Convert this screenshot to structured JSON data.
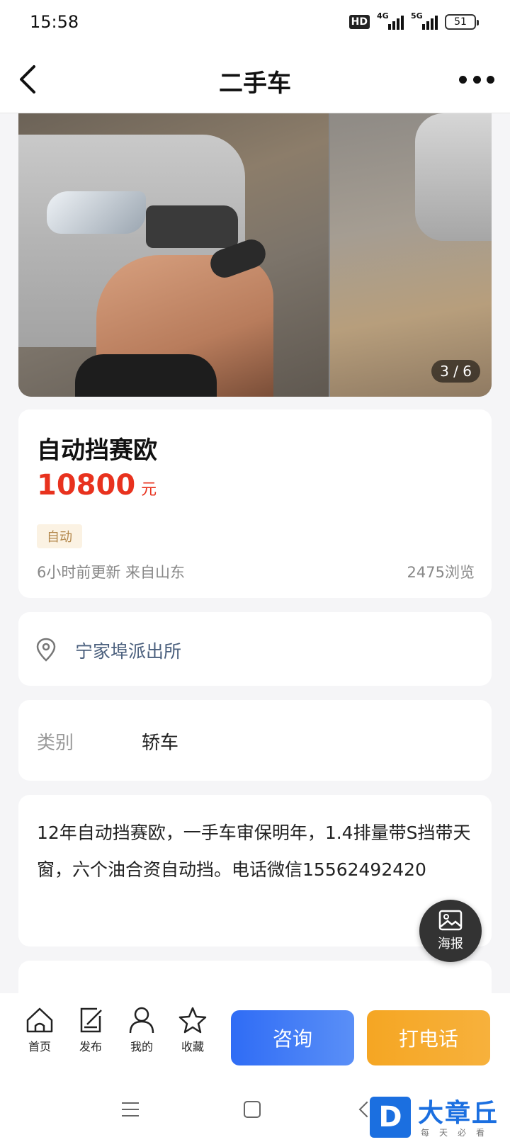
{
  "status_bar": {
    "time": "15:58",
    "hd": "HD",
    "net1": "4G",
    "net2": "5G",
    "battery": "51"
  },
  "header": {
    "title": "二手车",
    "back_icon": "chevron-left-icon",
    "more_icon": "more-dots-icon"
  },
  "gallery": {
    "counter": "3 / 6"
  },
  "listing": {
    "title": "自动挡赛欧",
    "price": "10800",
    "price_unit": "元",
    "tag": "自动",
    "meta": "6小时前更新 来自山东",
    "views": "2475浏览",
    "price_color": "#e8321e"
  },
  "location": {
    "text": "宁家埠派出所",
    "icon": "location-pin-icon"
  },
  "category": {
    "label": "类别",
    "value": "轿车"
  },
  "description": {
    "text": "12年自动挡赛欧，一手车审保明年，1.4排量带S挡带天窗，六个油合资自动挡。电话微信15562492420"
  },
  "poster": {
    "label": "海报",
    "icon": "image-icon"
  },
  "bottom_bar": {
    "tabs": [
      {
        "label": "首页",
        "icon": "home-icon"
      },
      {
        "label": "发布",
        "icon": "edit-icon"
      },
      {
        "label": "我的",
        "icon": "user-icon"
      },
      {
        "label": "收藏",
        "icon": "star-icon"
      }
    ],
    "consult_label": "咨询",
    "call_label": "打电话",
    "consult_color": "#2f6cf5",
    "call_color": "#f5a623"
  },
  "watermark": {
    "logo_letter": "D",
    "brand": "大章丘",
    "sub": "每天必看"
  }
}
